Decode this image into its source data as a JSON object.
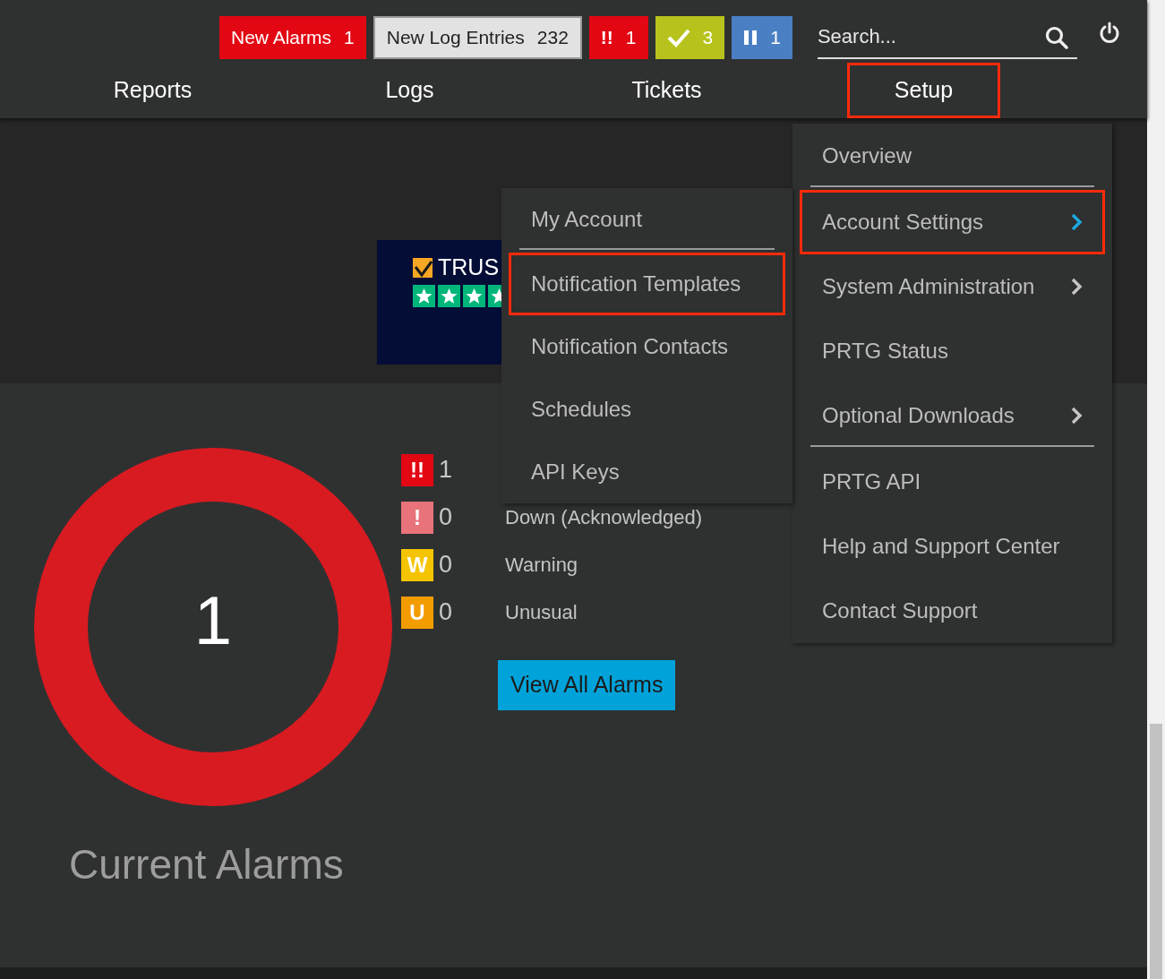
{
  "top_badges": [
    {
      "kind": "text",
      "label": "New Alarms",
      "count": "1",
      "color": "#e30613"
    },
    {
      "kind": "text",
      "label": "New Log Entries",
      "count": "232",
      "color": "#e2e2e2"
    },
    {
      "kind": "glyph",
      "label": "!!",
      "count": "1",
      "color": "#e30613"
    },
    {
      "kind": "check",
      "count": "3",
      "color": "#b7c31c"
    },
    {
      "kind": "pause",
      "count": "1",
      "color": "#4a7fc3"
    }
  ],
  "search": {
    "placeholder": "Search..."
  },
  "nav": [
    {
      "label": "Reports",
      "highlighted": false
    },
    {
      "label": "Logs",
      "highlighted": false
    },
    {
      "label": "Tickets",
      "highlighted": false
    },
    {
      "label": "Setup",
      "highlighted": true
    }
  ],
  "banner": {
    "text": "TRUS"
  },
  "setup_menu": [
    {
      "label": "Overview",
      "kind": "plain",
      "highlighted": false,
      "divider_after": true
    },
    {
      "label": "Account Settings",
      "kind": "open",
      "highlighted": true,
      "divider_after": false
    },
    {
      "label": "System Administration",
      "kind": "submenu",
      "highlighted": false,
      "divider_after": false
    },
    {
      "label": "PRTG Status",
      "kind": "plain",
      "highlighted": false,
      "divider_after": false
    },
    {
      "label": "Optional Downloads",
      "kind": "submenu",
      "highlighted": false,
      "divider_after": true
    },
    {
      "label": "PRTG API",
      "kind": "plain",
      "highlighted": false,
      "divider_after": false
    },
    {
      "label": "Help and Support Center",
      "kind": "plain",
      "highlighted": false,
      "divider_after": false
    },
    {
      "label": "Contact Support",
      "kind": "plain",
      "highlighted": false,
      "divider_after": false
    }
  ],
  "account_submenu": [
    {
      "label": "My Account",
      "highlighted": false,
      "divider_after": true
    },
    {
      "label": "Notification Templates",
      "highlighted": true,
      "divider_after": false
    },
    {
      "label": "Notification Contacts",
      "highlighted": false,
      "divider_after": false
    },
    {
      "label": "Schedules",
      "highlighted": false,
      "divider_after": false
    },
    {
      "label": "API Keys",
      "highlighted": false,
      "divider_after": false
    }
  ],
  "alarms": {
    "total": "1",
    "title": "Current Alarms",
    "rows": [
      {
        "glyph": "!!",
        "count": "1",
        "color": "#e30613"
      },
      {
        "glyph": "!",
        "count": "0",
        "label": "Down (Acknowledged)",
        "color": "#e8737a"
      },
      {
        "glyph": "W",
        "count": "0",
        "label": "Warning",
        "color": "#f5c400"
      },
      {
        "glyph": "U",
        "count": "0",
        "label": "Unusual",
        "color": "#f39c00"
      }
    ],
    "button": "View All Alarms"
  }
}
